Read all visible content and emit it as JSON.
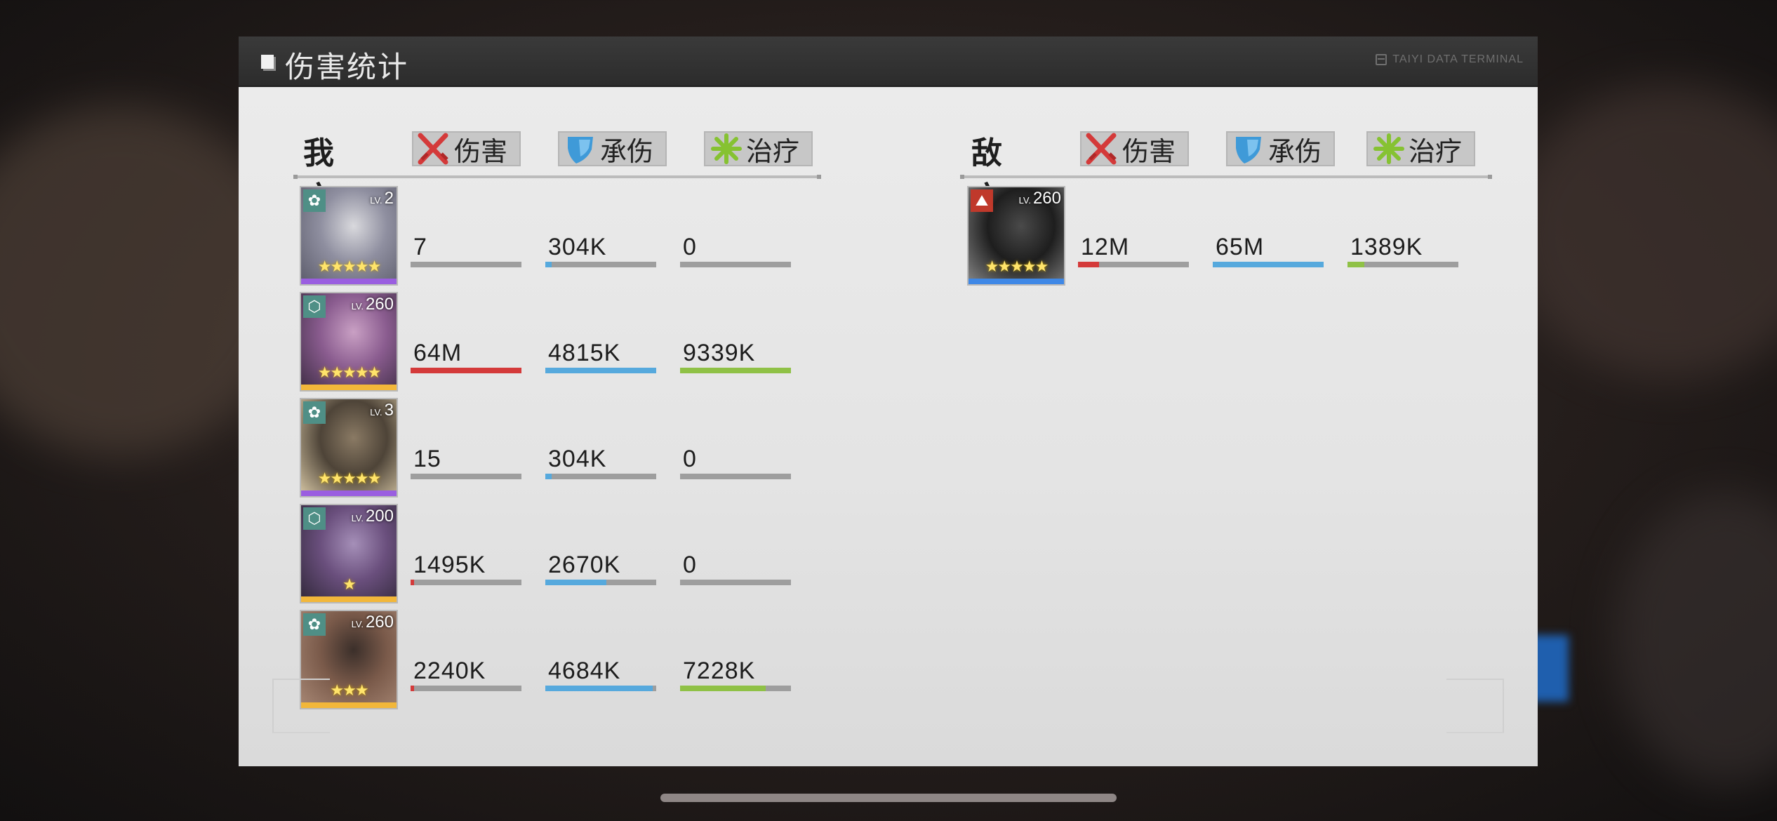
{
  "header": {
    "title": "伤害统计",
    "terminal_label": "TAIYI DATA TERMINAL"
  },
  "tabs": {
    "damage": "伤害",
    "taken": "承伤",
    "heal": "治疗"
  },
  "colors": {
    "damage": "#d43a3a",
    "taken": "#56a9dd",
    "heal": "#8fc146",
    "rarity_purple": "#9a5ee0",
    "rarity_gold": "#f2b73a",
    "rarity_blue": "#3f88e6"
  },
  "ally": {
    "label": "我方",
    "members": [
      {
        "lv_prefix": "LV.",
        "lv": "2",
        "class_icon": "tactician-icon",
        "stars": "★★★★★",
        "rarity": "purple",
        "damage": "7",
        "damage_fill": 0.0,
        "taken": "304K",
        "taken_fill": 0.06,
        "heal": "0",
        "heal_fill": 0.0
      },
      {
        "lv_prefix": "LV.",
        "lv": "260",
        "class_icon": "guardian-icon",
        "stars": "★★★★★",
        "rarity": "gold",
        "damage": "64M",
        "damage_fill": 1.0,
        "taken": "4815K",
        "taken_fill": 1.0,
        "heal": "9339K",
        "heal_fill": 1.0
      },
      {
        "lv_prefix": "LV.",
        "lv": "3",
        "class_icon": "tactician-icon",
        "stars": "★★★★★",
        "rarity": "purple",
        "damage": "15",
        "damage_fill": 0.0,
        "taken": "304K",
        "taken_fill": 0.06,
        "heal": "0",
        "heal_fill": 0.0
      },
      {
        "lv_prefix": "LV.",
        "lv": "200",
        "class_icon": "guardian-icon",
        "stars": "★",
        "rarity": "gold",
        "damage": "1495K",
        "damage_fill": 0.02,
        "taken": "2670K",
        "taken_fill": 0.55,
        "heal": "0",
        "heal_fill": 0.0
      },
      {
        "lv_prefix": "LV.",
        "lv": "260",
        "class_icon": "tactician-icon",
        "stars": "★★★",
        "rarity": "gold",
        "damage": "2240K",
        "damage_fill": 0.03,
        "taken": "4684K",
        "taken_fill": 0.97,
        "heal": "7228K",
        "heal_fill": 0.77
      }
    ]
  },
  "enemy": {
    "label": "敌方",
    "members": [
      {
        "lv_prefix": "LV.",
        "lv": "260",
        "class_icon": "striker-icon",
        "stars": "★★★★★",
        "rarity": "blue",
        "damage": "12M",
        "damage_fill": 0.19,
        "taken": "65M",
        "taken_fill": 1.0,
        "heal": "1389K",
        "heal_fill": 0.15
      }
    ]
  }
}
